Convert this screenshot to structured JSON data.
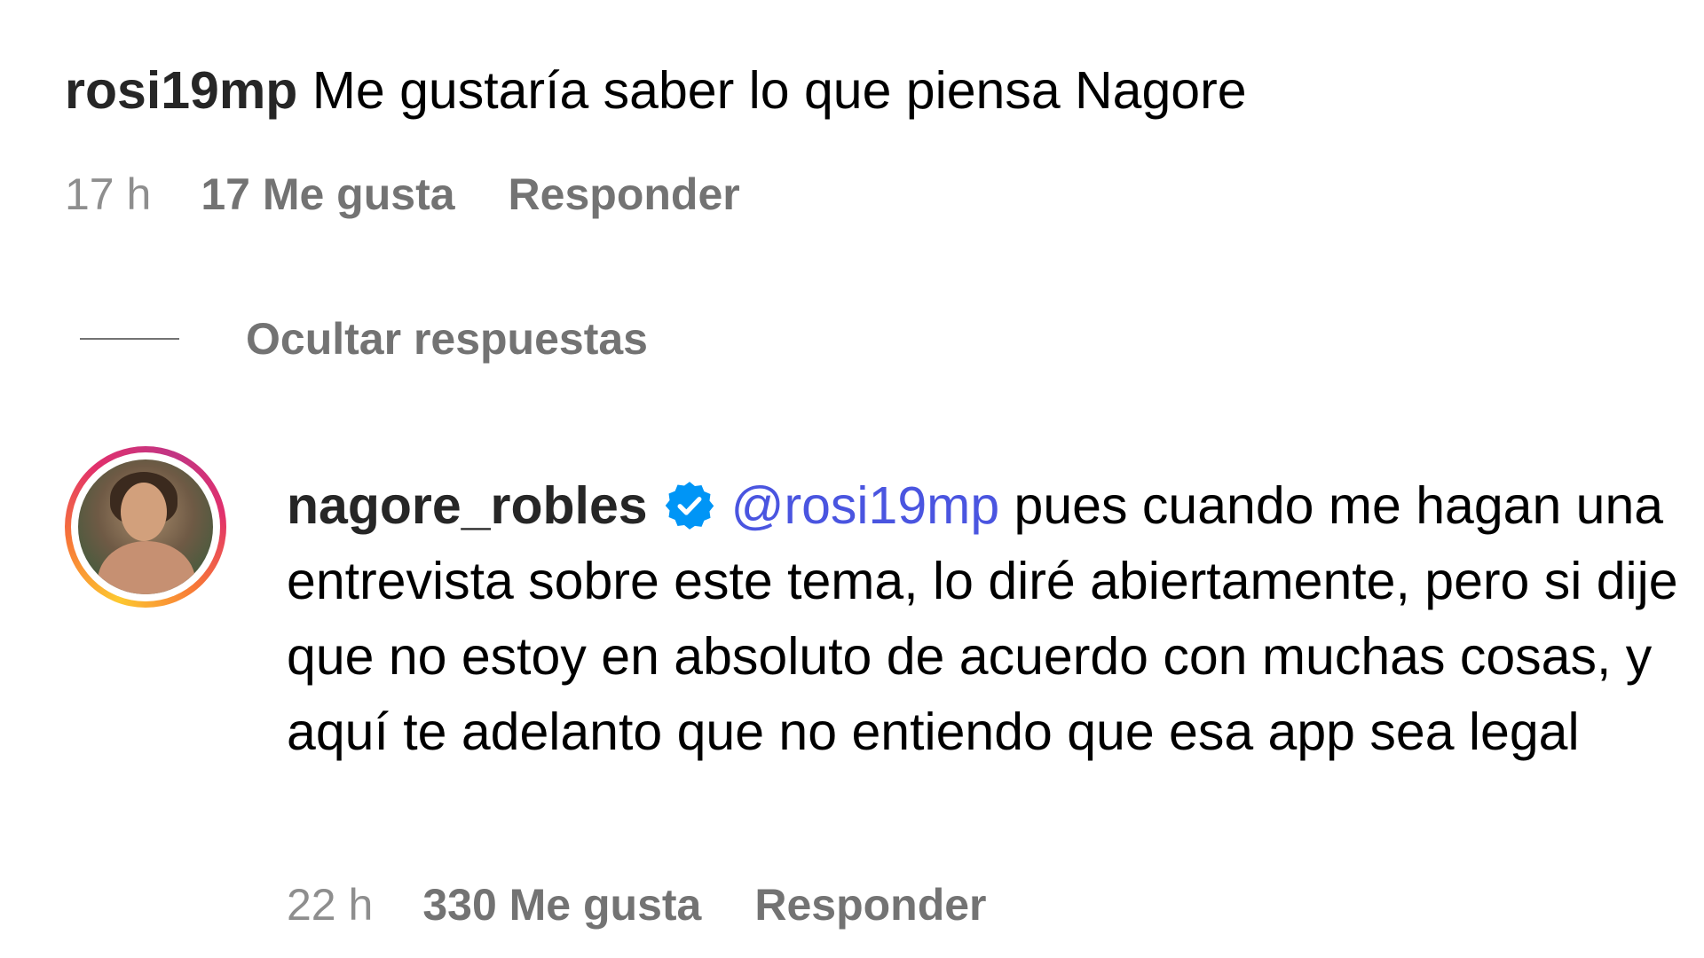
{
  "parent_comment": {
    "username": "rosi19mp",
    "text": "Me gustaría saber lo que piensa Nagore",
    "time": "17 h",
    "likes": "17 Me gusta",
    "reply_label": "Responder"
  },
  "hide_replies_label": "Ocultar respuestas",
  "reply": {
    "username": "nagore_robles",
    "verified": true,
    "mention": "@rosi19mp",
    "text": "pues cuando me hagan una entrevista sobre este tema, lo diré abiertamente, pero si dije que no estoy en absoluto de acuerdo con muchas cosas, y aquí te adelanto que no entiendo que esa app sea legal",
    "time": "22 h",
    "likes": "330 Me gusta",
    "reply_label": "Responder"
  },
  "colors": {
    "mention": "#4a55e0",
    "verified": "#0095f6",
    "meta": "#737373"
  },
  "icons": [
    "verified-badge-icon"
  ]
}
